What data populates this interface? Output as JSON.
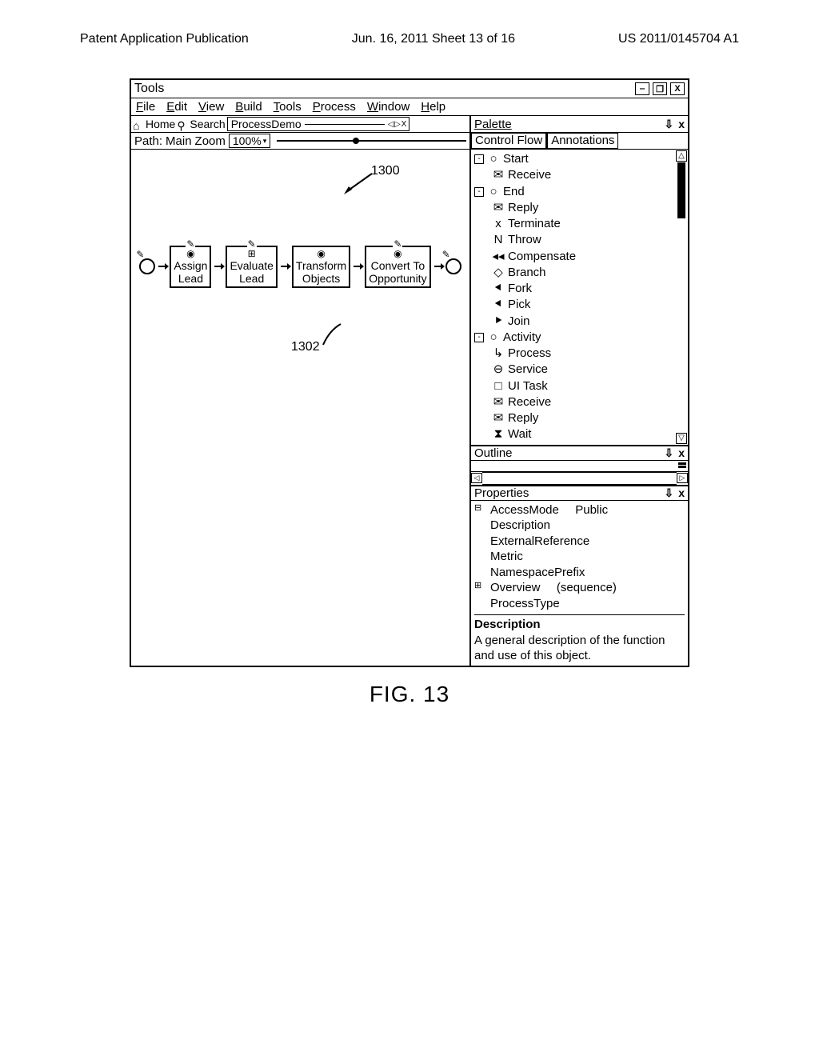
{
  "doc_header": {
    "left": "Patent Application Publication",
    "center": "Jun. 16, 2011  Sheet 13 of 16",
    "right": "US 2011/0145704 A1"
  },
  "window": {
    "title": "Tools",
    "menubar": [
      "File",
      "Edit",
      "View",
      "Build",
      "Tools",
      "Process",
      "Window",
      "Help"
    ],
    "tabs": {
      "home": "Home",
      "search": "Search",
      "doc": "ProcessDemo"
    },
    "path_label": "Path:",
    "path_value": "Main",
    "zoom_label": "Zoom",
    "zoom_value": "100%"
  },
  "flow_nodes": {
    "n1": {
      "line1": "Assign",
      "line2": "Lead"
    },
    "n2": {
      "line1": "Evaluate",
      "line2": "Lead"
    },
    "n3": {
      "line1": "Transform",
      "line2": "Objects"
    },
    "n4": {
      "line1": "Convert To",
      "line2": "Opportunity"
    }
  },
  "refs": {
    "r1": "1300",
    "r2": "1302"
  },
  "palette": {
    "title": "Palette",
    "tab1": "Control Flow",
    "tab2": "Annotations",
    "items": {
      "start": "Start",
      "receive": "Receive",
      "end": "End",
      "reply": "Reply",
      "terminate": "Terminate",
      "throw": "Throw",
      "compensate": "Compensate",
      "branch": "Branch",
      "fork": "Fork",
      "pick": "Pick",
      "join": "Join",
      "activity": "Activity",
      "process": "Process",
      "service": "Service",
      "uitask": "UI Task",
      "receive2": "Receive",
      "reply2": "Reply",
      "wait": "Wait"
    }
  },
  "outline": {
    "title": "Outline"
  },
  "properties": {
    "title": "Properties",
    "rows": {
      "access_k": "AccessMode",
      "access_v": "Public",
      "desc": "Description",
      "ext": "ExternalReference",
      "metric": "Metric",
      "ns": "NamespacePrefix",
      "overview_k": "Overview",
      "overview_v": "(sequence)",
      "ptype": "ProcessType"
    },
    "desc_head": "Description",
    "desc_body": "A general description of the function and use of this object."
  },
  "figure_label": "FIG. 13"
}
